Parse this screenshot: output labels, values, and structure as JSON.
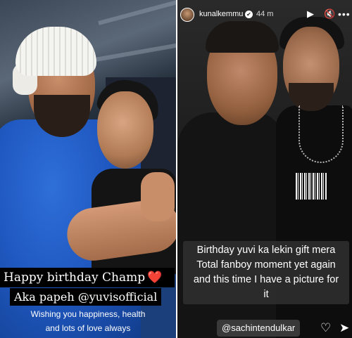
{
  "left_story": {
    "caption_line1": "Happy birthday Champ",
    "caption_line1_emoji": "❤️",
    "caption_line2": "Aka papeh @yuvisofficial",
    "caption_line3": "Wishing you happiness, health",
    "caption_line4": "and lots of love always"
  },
  "right_story": {
    "header": {
      "username": "kunalkemmu",
      "verified_icon": "✔",
      "time_ago": "44 m",
      "play_icon": "▶",
      "mute_icon": "🔇",
      "more_icon": "•••"
    },
    "caption_lines": [
      "Birthday yuvi ka lekin gift mera",
      "Total fanboy moment yet again",
      "and this time I have a picture for",
      "it"
    ],
    "mention": "@sachintendulkar",
    "heart_icon": "♡",
    "send_icon": "➤"
  },
  "colors": {
    "heart_red": "#e1172d",
    "caption_black": "#000000",
    "caption_gray": "#2d2d2d"
  }
}
